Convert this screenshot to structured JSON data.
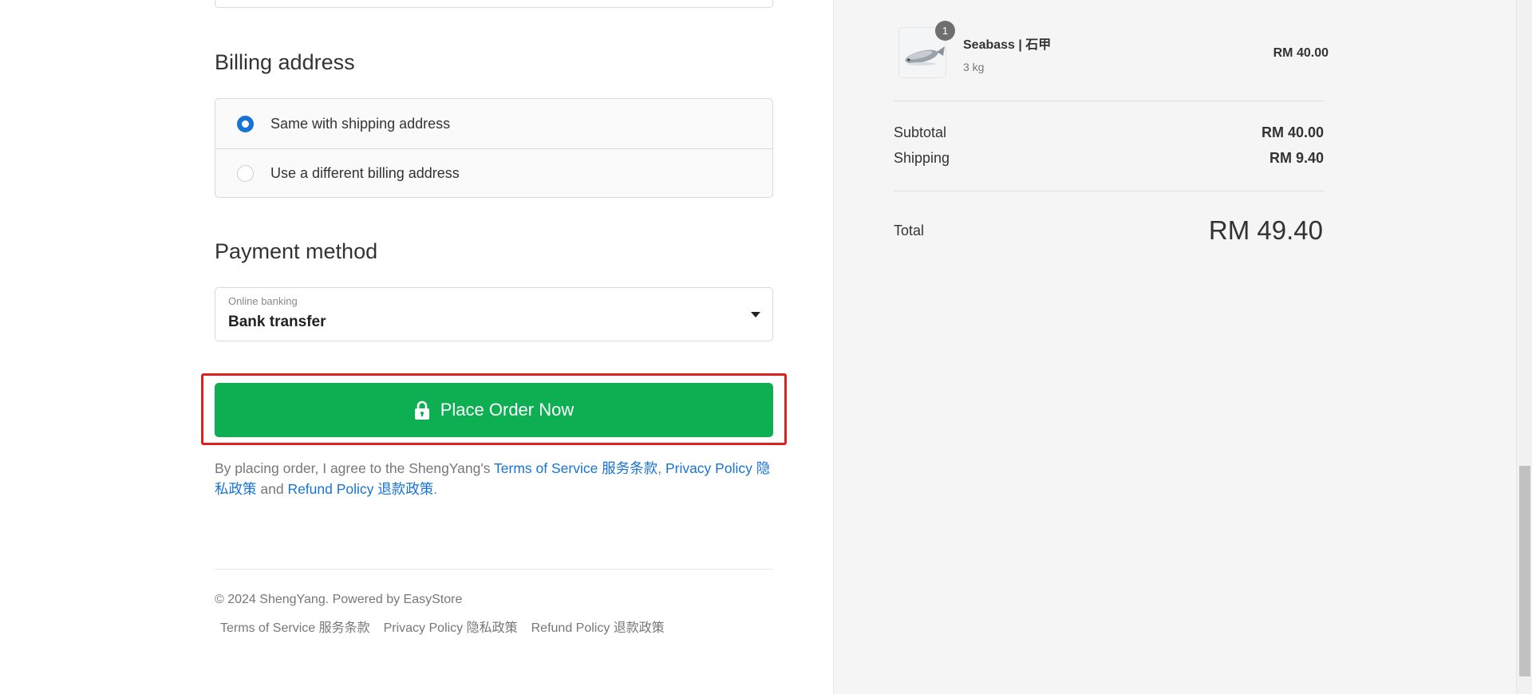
{
  "billing": {
    "title": "Billing address",
    "options": [
      {
        "label": "Same with shipping address",
        "selected": true
      },
      {
        "label": "Use a different billing address",
        "selected": false
      }
    ]
  },
  "payment": {
    "title": "Payment method",
    "caption": "Online banking",
    "selected": "Bank transfer"
  },
  "order_button": {
    "label": "Place Order Now",
    "icon": "lock-icon",
    "color": "#0daf52",
    "highlight_color": "#e02020"
  },
  "agreement": {
    "prefix": "By placing order, I agree to the ShengYang's ",
    "terms": "Terms of Service 服务条款",
    "sep": ", ",
    "privacy": "Privacy Policy 隐私政策",
    "and": " and ",
    "refund": "Refund Policy 退款政策",
    "suffix": "."
  },
  "footer": {
    "copyright": "© 2024 ShengYang. Powered by  EasyStore",
    "links": [
      "Terms of Service 服务条款",
      "Privacy Policy 隐私政策",
      "Refund Policy 退款政策"
    ]
  },
  "summary": {
    "item": {
      "quantity": "1",
      "name": "Seabass | 石甲",
      "variant": "3 kg",
      "price": "RM 40.00"
    },
    "subtotal_label": "Subtotal",
    "subtotal_value": "RM 40.00",
    "shipping_label": "Shipping",
    "shipping_value": "RM 9.40",
    "total_label": "Total",
    "total_value": "RM 49.40"
  }
}
